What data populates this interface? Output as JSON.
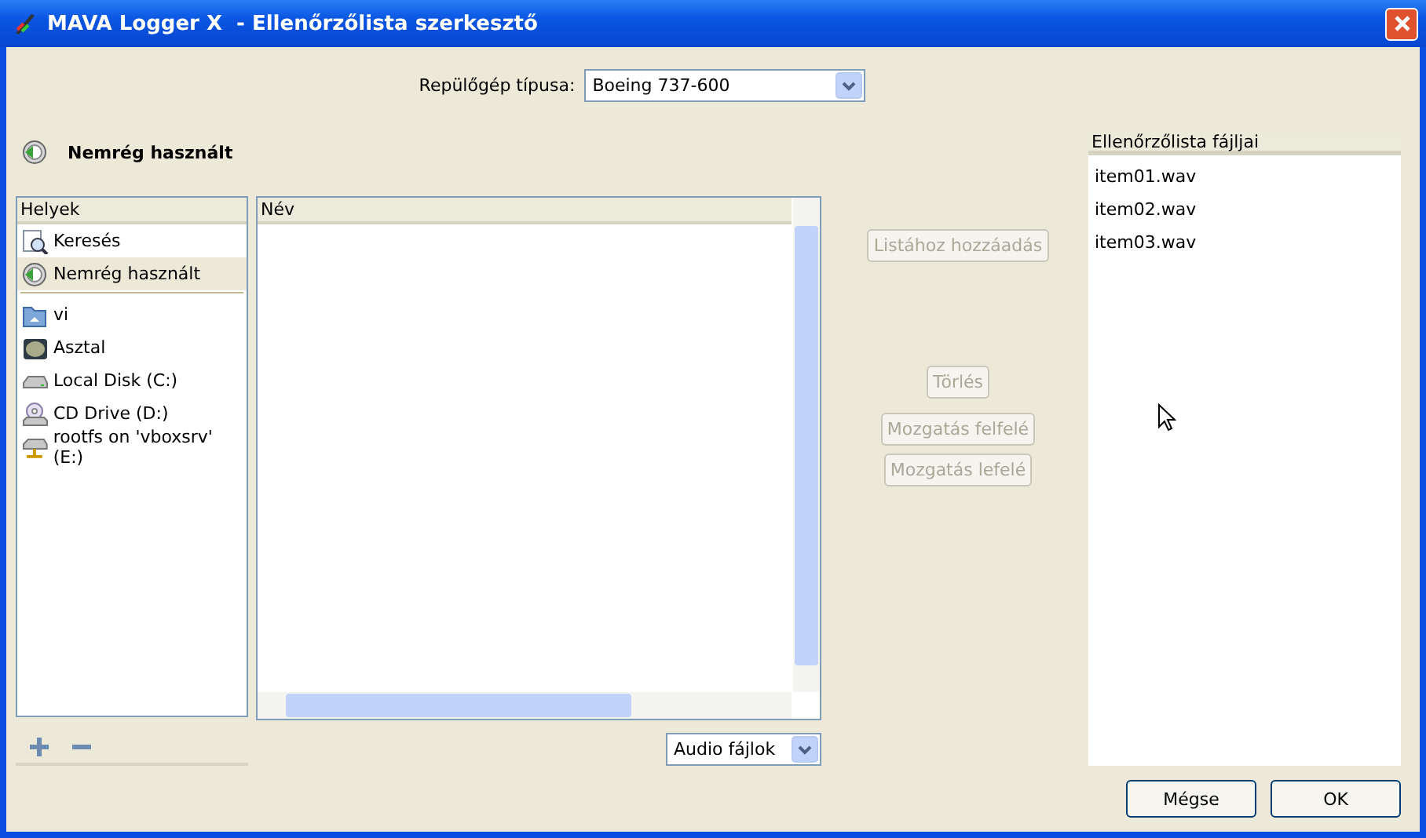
{
  "window": {
    "title": "MAVA Logger X  - Ellenőrzőlista szerkesztő"
  },
  "aircraft": {
    "label": "Repülőgép típusa:",
    "value": "Boeing 737-600"
  },
  "location_header": {
    "title": "Nemrég használt"
  },
  "places": {
    "heading": "Helyek",
    "items": [
      {
        "label": "Keresés",
        "kind": "search",
        "selected": false
      },
      {
        "label": "Nemrég használt",
        "kind": "recent",
        "selected": true
      },
      {
        "label": "vi",
        "kind": "home",
        "selected": false
      },
      {
        "label": "Asztal",
        "kind": "desktop",
        "selected": false
      },
      {
        "label": "Local Disk (C:)",
        "kind": "disk",
        "selected": false
      },
      {
        "label": "CD Drive (D:)",
        "kind": "cd",
        "selected": false
      },
      {
        "label": "rootfs on 'vboxsrv' (E:)",
        "kind": "network",
        "selected": false
      }
    ]
  },
  "files": {
    "columns": [
      "Név"
    ],
    "filter": "Audio fájlok"
  },
  "actions": [
    {
      "label": "Listához hozzáadás",
      "disabled": true
    },
    {
      "label": "Törlés",
      "disabled": true
    },
    {
      "label": "Mozgatás felfelé",
      "disabled": true
    },
    {
      "label": "Mozgatás lefelé",
      "disabled": true
    }
  ],
  "checklist": {
    "heading": "Ellenőrzőlista fájljai",
    "items": [
      "item01.wav",
      "item02.wav",
      "item03.wav"
    ]
  },
  "buttons": [
    "Mégse",
    "OK"
  ]
}
